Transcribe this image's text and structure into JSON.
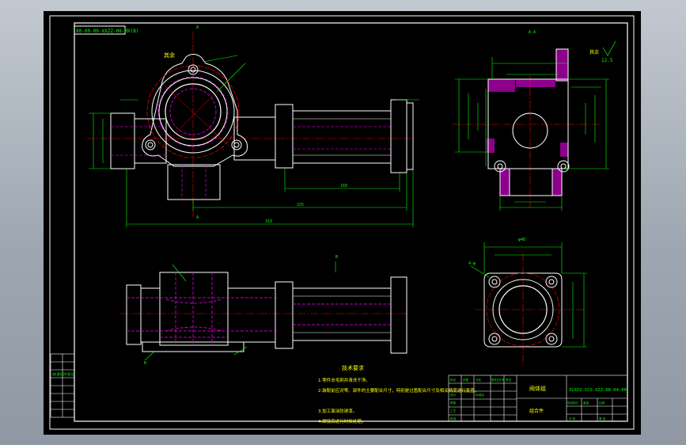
{
  "colors": {
    "paper": "#000000",
    "frame": "#ffffff",
    "outline": "#ffffff",
    "dimension": "#00ff00",
    "hidden": "#ff00ff",
    "center": "#ff0000",
    "hatch": "#ff00ff",
    "note": "#ffff00"
  },
  "labels": {
    "drawing_code": "80-00-00-XXZZ-08-MX(B)",
    "section_mark_a": "A",
    "section_mark_a_lower": "A",
    "section_title": "A-A",
    "view_title": "B",
    "bottom_view_title": "B",
    "roughness": "12.5",
    "roughness_suffix": "其余",
    "dim_overall_1": "225",
    "dim_overall_2": "310",
    "dim_length": "160",
    "part_name": "阀体组",
    "material": "组合件",
    "part_number": "ZLXXZ-CCS-XZZ-08-04-00",
    "left_block_label": "借(通)用件登记",
    "hole_callout_1": "4-φ",
    "hole_callout_2": "φ48"
  },
  "notes": {
    "title": "技术要求",
    "items": [
      "1.零件去毛刺并清洗干净。",
      "2.装配前应对零、部件的主要配合尺寸，特别是过盈配合尺寸及相关精度进行复查。",
      "3.加工面涂防锈漆。",
      "4.焊接后进行时效处理。"
    ]
  },
  "title_block": {
    "cells": [
      "标记",
      "处数",
      "分区",
      "更改文件号",
      "签名",
      "年月日",
      "设计",
      "标准化",
      "审核",
      "工艺",
      "批准",
      "阶段标记",
      "重量",
      "比例",
      "共 张",
      "第 张"
    ]
  }
}
